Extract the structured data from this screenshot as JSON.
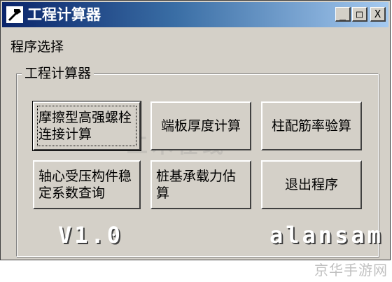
{
  "window": {
    "title": "工程计算器",
    "controls": {
      "minimize": "_",
      "maximize": "□",
      "close": "X"
    }
  },
  "menu": {
    "items": [
      "程序选择"
    ]
  },
  "group": {
    "label": "工程计算器"
  },
  "buttons": {
    "friction_bolt": "摩擦型高强螺栓连接计算",
    "end_plate": "端板厚度计算",
    "column_rebar": "柱配筋率验算",
    "axial_member": "轴心受压构件稳定系数查询",
    "pile_capacity": "桩基承载力估算",
    "exit": "退出程序"
  },
  "footer": {
    "version": "V1.0",
    "author": "alansam"
  },
  "colors": {
    "titlebar_start": "#0a246a",
    "titlebar_end": "#a6caf0",
    "face": "#d4d0c8"
  },
  "icons": {
    "app": "hammer-icon"
  },
  "overlays": {
    "site_watermark": "京华手游网"
  }
}
